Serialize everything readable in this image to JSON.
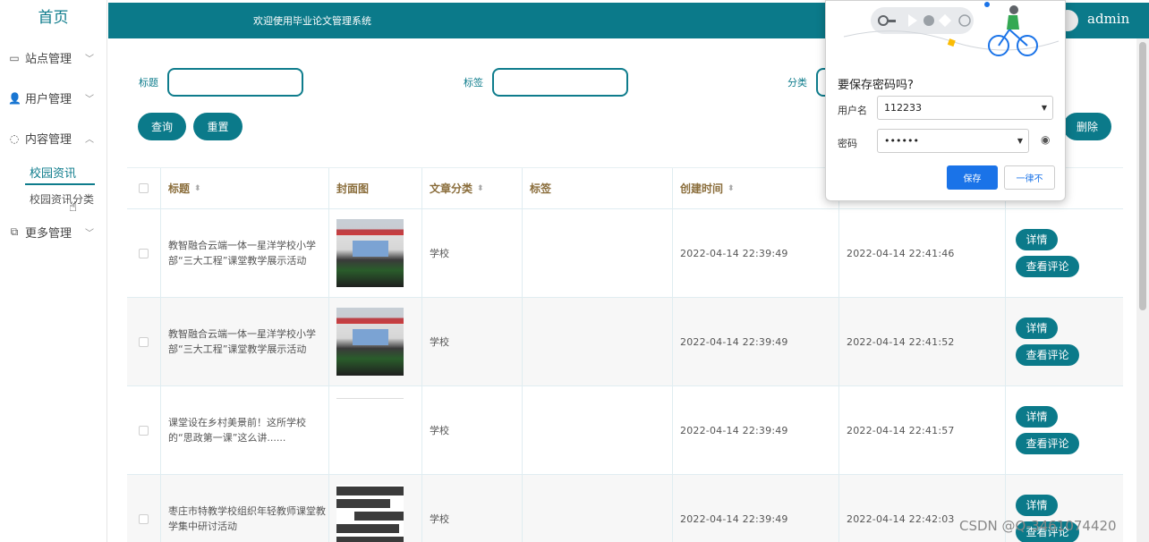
{
  "sidebar": {
    "home": "首页",
    "menus": [
      {
        "label": "站点管理",
        "icon": "monitor-icon"
      },
      {
        "label": "用户管理",
        "icon": "user-icon"
      },
      {
        "label": "内容管理",
        "icon": "chat-icon"
      },
      {
        "label": "更多管理",
        "icon": "copy-icon"
      }
    ],
    "sub_items": [
      "校园资讯",
      "校园资讯分类"
    ]
  },
  "header": {
    "welcome": "欢迎使用毕业论文管理系统",
    "user": "admin"
  },
  "search": {
    "title_label": "标题",
    "tag_label": "标签",
    "category_label": "分类",
    "query_button": "查询",
    "reset_button": "重置",
    "delete_button": "删除"
  },
  "table": {
    "columns": [
      "标题",
      "封面图",
      "文章分类",
      "标签",
      "创建时间"
    ],
    "rows": [
      {
        "title": "教智融合云端一体一星洋学校小学部“三大工程”课堂教学展示活动",
        "category": "学校",
        "tag": "",
        "created": "2022-04-14 22:39:49",
        "updated": "2022-04-14 22:41:46"
      },
      {
        "title": "教智融合云端一体一星洋学校小学部“三大工程”课堂教学展示活动",
        "category": "学校",
        "tag": "",
        "created": "2022-04-14 22:39:49",
        "updated": "2022-04-14 22:41:52"
      },
      {
        "title": "课堂设在乡村美景前！这所学校的“思政第一课”这么讲......",
        "category": "学校",
        "tag": "",
        "created": "2022-04-14 22:39:49",
        "updated": "2022-04-14 22:41:57"
      },
      {
        "title": "枣庄市特教学校组织年轻教师课堂教学集中研讨活动",
        "category": "学校",
        "tag": "",
        "created": "2022-04-14 22:39:49",
        "updated": "2022-04-14 22:42:03"
      }
    ],
    "detail_button": "详情",
    "comments_button": "查看评论"
  },
  "password_popup": {
    "title": "要保存密码吗?",
    "username_label": "用户名",
    "username_value": "112233",
    "password_label": "密码",
    "password_value": "••••••",
    "save_button": "保存",
    "never_button": "一律不"
  },
  "watermark": "CSDN @Q-3461074420",
  "colors": {
    "primary": "#0b7a8a",
    "popup_blue": "#1a73e8"
  }
}
